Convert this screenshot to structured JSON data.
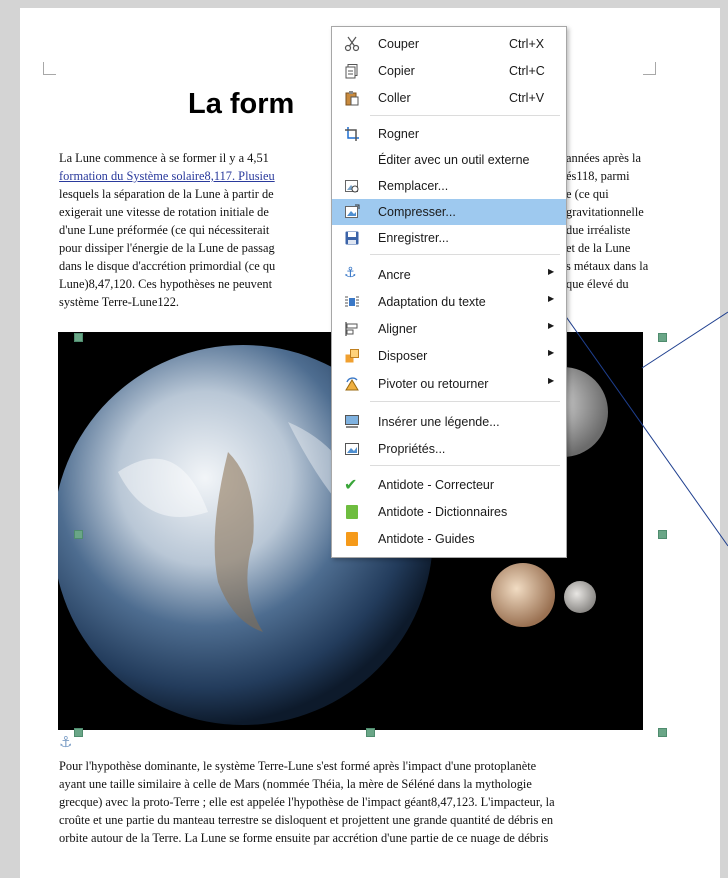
{
  "document": {
    "title": "La form",
    "para1_left": [
      "La Lune commence à se former il y a 4,51",
      "formation du Système solaire8,117. Plusieu",
      "lesquels la séparation de la Lune à partir de",
      "exigerait une vitesse de rotation initiale de",
      "d'une Lune préformée (ce qui nécessiterait",
      "pour dissiper l'énergie de la Lune de passag",
      "dans le disque d'accrétion primordial (ce qu",
      "Lune)8,47,120. Ces hypothèses ne peuvent",
      "système Terre-Lune122."
    ],
    "para1_right": [
      "années après la",
      "és118, parmi",
      "e (ce qui",
      "gravitationnelle",
      "due irréaliste",
      "et de la Lune",
      "s métaux dans la",
      "que élevé du"
    ],
    "para2": [
      "Pour l'hypothèse dominante, le système Terre-Lune s'est formé après l'impact d'une protoplanète",
      "ayant une taille similaire à celle de Mars (nommée Théia, la mère de Séléné dans la mythologie",
      "grecque) avec la proto-Terre ; elle est appelée l'hypothèse de l'impact géant8,47,123. L'impacteur, la",
      "croûte et une partie du manteau terrestre se disloquent et projettent une grande quantité de débris en",
      "orbite autour de la Terre. La Lune se forme ensuite par accrétion d'une partie de ce nuage de débris"
    ]
  },
  "menu": {
    "items": [
      {
        "label": "Couper",
        "shortcut": "Ctrl+X",
        "icon": "scissors-icon"
      },
      {
        "label": "Copier",
        "shortcut": "Ctrl+C",
        "icon": "copy-icon"
      },
      {
        "label": "Coller",
        "shortcut": "Ctrl+V",
        "icon": "paste-icon"
      },
      {
        "label": "Rogner",
        "shortcut": "",
        "icon": "crop-icon"
      },
      {
        "label": "Éditer avec un outil externe",
        "shortcut": "",
        "icon": ""
      },
      {
        "label": "Remplacer...",
        "shortcut": "",
        "icon": "replace-image-icon"
      },
      {
        "label": "Compresser...",
        "shortcut": "",
        "icon": "compress-icon",
        "highlighted": true
      },
      {
        "label": "Enregistrer...",
        "shortcut": "",
        "icon": "save-icon"
      },
      {
        "label": "Ancre",
        "shortcut": "",
        "icon": "anchor-icon",
        "submenu": true
      },
      {
        "label": "Adaptation du texte",
        "shortcut": "",
        "icon": "wrap-icon",
        "submenu": true
      },
      {
        "label": "Aligner",
        "shortcut": "",
        "icon": "align-icon",
        "submenu": true
      },
      {
        "label": "Disposer",
        "shortcut": "",
        "icon": "arrange-icon",
        "submenu": true
      },
      {
        "label": "Pivoter ou retourner",
        "shortcut": "",
        "icon": "rotate-icon",
        "submenu": true
      },
      {
        "label": "Insérer une légende...",
        "shortcut": "",
        "icon": "caption-icon"
      },
      {
        "label": "Propriétés...",
        "shortcut": "",
        "icon": "properties-icon"
      },
      {
        "label": "Antidote - Correcteur",
        "shortcut": "",
        "icon": "checkmark-icon"
      },
      {
        "label": "Antidote - Dictionnaires",
        "shortcut": "",
        "icon": "green-book-icon"
      },
      {
        "label": "Antidote - Guides",
        "shortcut": "",
        "icon": "orange-book-icon"
      }
    ]
  },
  "colors": {
    "highlight": "#9ec9ef",
    "link": "#2a3a9c",
    "handle": "#6aa687"
  }
}
